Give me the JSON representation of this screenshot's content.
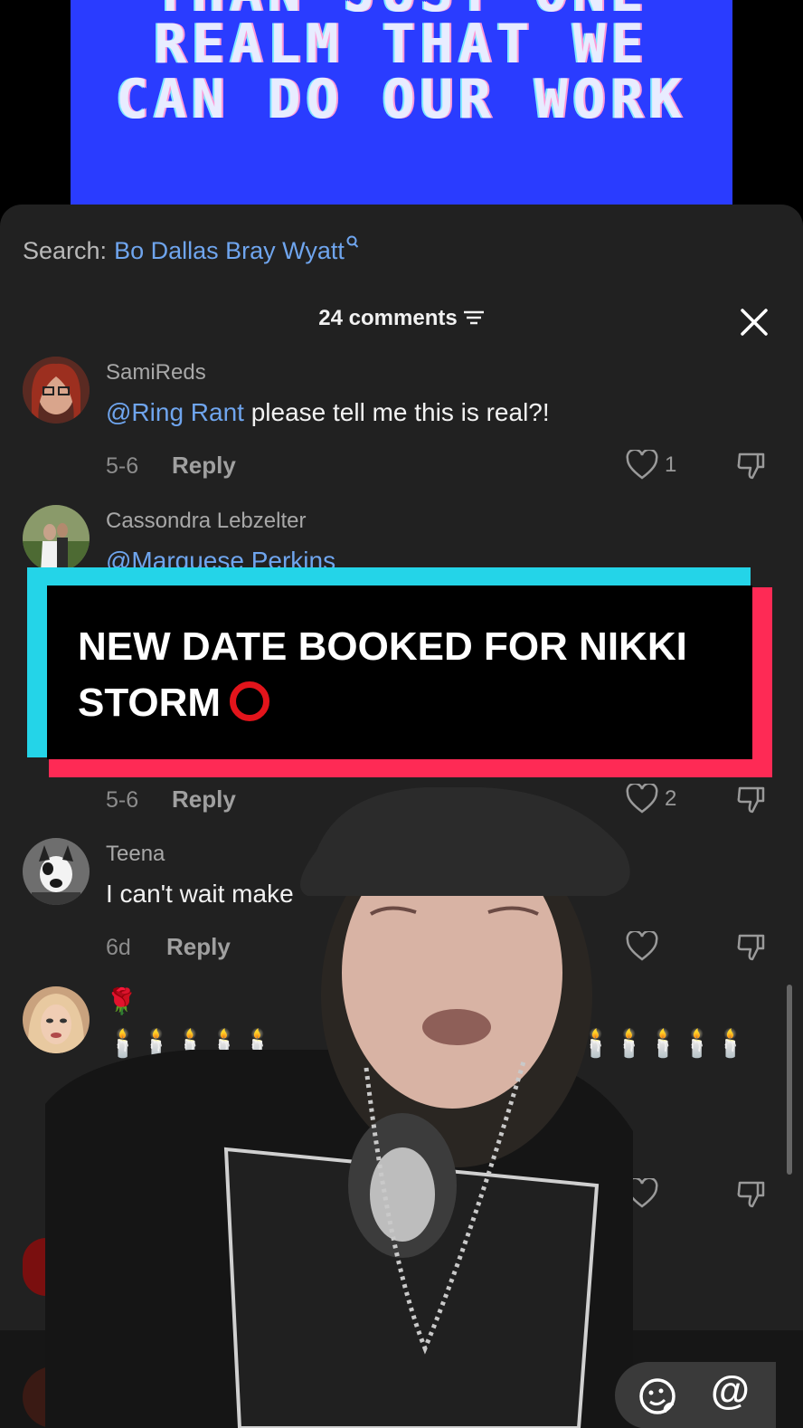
{
  "video": {
    "line0": "THAN JUST ONE",
    "line1": "REALM THAT WE",
    "line2": "CAN DO OUR WORK"
  },
  "search": {
    "label": "Search:",
    "term": "Bo Dallas Bray Wyatt"
  },
  "header": {
    "comments_label": "24 comments"
  },
  "comments": [
    {
      "username": "SamiReds",
      "mention": "@Ring Rant",
      "text": " please tell me this is real?!",
      "date": "5-6",
      "reply_label": "Reply",
      "likes": "1"
    },
    {
      "username": "Cassondra Lebzelter",
      "text": "@Marquese Perkins",
      "date": "5-6",
      "reply_label": "Reply",
      "likes": "2"
    },
    {
      "username": "Teena",
      "text": "I can't wait make",
      "date": "6d",
      "reply_label": "Reply",
      "likes": ""
    },
    {
      "username": "",
      "emoji_line1": "🌹",
      "candles_line1": "🕯️🕯️🕯️🕯️🕯️",
      "candles_line1b": "🕯️🕯️🕯️🕯️🕯️",
      "candles_line2": "🕯️🕯️"
    }
  ],
  "banner": {
    "line1": "NEW DATE BOOKED FOR NIKKI",
    "line2": "STORM"
  },
  "input": {
    "at_label": "@"
  },
  "colors": {
    "panel_bg": "#212121",
    "mention": "#6fa5ee",
    "banner_cyan": "#24d4e8",
    "banner_red": "#fe2a55",
    "video_blue": "#2a3cff"
  }
}
